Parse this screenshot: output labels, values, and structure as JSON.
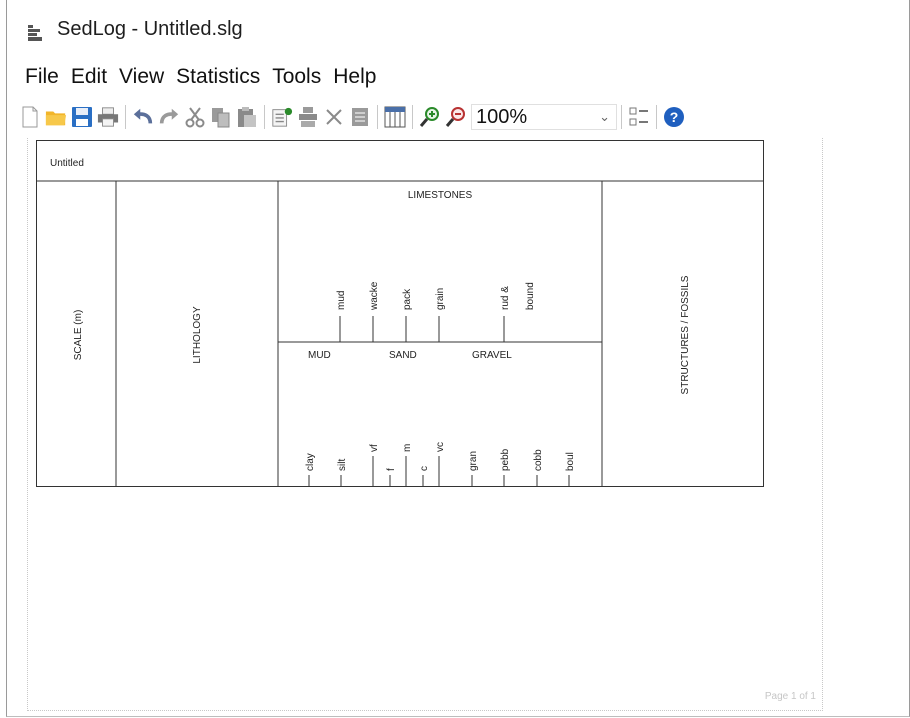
{
  "window": {
    "title": "SedLog - Untitled.slg"
  },
  "menu": {
    "items": [
      "File",
      "Edit",
      "View",
      "Statistics",
      "Tools",
      "Help"
    ]
  },
  "toolbar": {
    "zoom_value": "100%"
  },
  "log": {
    "title": "Untitled",
    "scale_label": "SCALE (m)",
    "lithology_label": "LITHOLOGY",
    "limestones_label": "LIMESTONES",
    "structures_label": "STRUCTURES / FOSSILS",
    "limestone_classes": [
      "mud",
      "wacke",
      "pack",
      "grain",
      "rud &",
      "bound"
    ],
    "grain_groups": [
      "MUD",
      "SAND",
      "GRAVEL"
    ],
    "grain_sizes": [
      "clay",
      "silt",
      "vf",
      "f",
      "m",
      "c",
      "vc",
      "gran",
      "pebb",
      "cobb",
      "boul"
    ]
  },
  "page": {
    "footer": "Page 1 of 1"
  },
  "colors": {
    "folder": "#f2b52a",
    "save": "#2a6fc4",
    "help": "#1f5fbf",
    "zoom": "#2a8a2a"
  }
}
